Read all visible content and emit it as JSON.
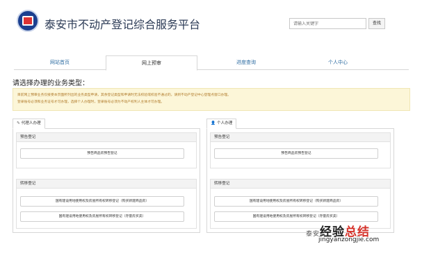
{
  "header": {
    "site_title": "泰安市不动产登记综合服务平台",
    "search_placeholder": "请输入关键字",
    "search_button": "查找"
  },
  "nav": {
    "items": [
      {
        "label": "网站首页"
      },
      {
        "label": "网上预审",
        "active": true
      },
      {
        "label": "进度查询"
      },
      {
        "label": "个人中心"
      }
    ]
  },
  "prompt": "请选择办理的业务类型：",
  "notice": {
    "line1": "目前网上预审业务仅接受本页面所列出的业务类型申请，其余登记类型和申请时无法校验或校验不通过的，请到不动产登记中心登理点窗口办理。",
    "line2": "登录账号必须和业务证号才可办理，选择个人办理时，登录账号必须为不动产权利人主体才可办理。"
  },
  "panels": {
    "agent": {
      "tab_label": "代理人办理",
      "section1": {
        "title": "预告登记",
        "buttons": [
          "预告商品房预告登记"
        ]
      },
      "section2": {
        "title": "转移登记",
        "buttons": [
          "国有建设用地使用权及房屋所有权转移登记（购买新建商品房）",
          "国有建设用地使用权及房屋所有权转移登记（存量房买卖）"
        ]
      }
    },
    "personal": {
      "tab_label": "个人办理",
      "section1": {
        "title": "预告登记",
        "buttons": [
          "预告商品房预告登记"
        ]
      },
      "section2": {
        "title": "转移登记",
        "buttons": [
          "国有建设用地使用权及房屋所有权转移登记（购买新建商品房）",
          "国有建设用地使用权及房屋所有权转移登记（存量房买卖）"
        ]
      }
    }
  },
  "watermark": {
    "brand_prefix": "泰安",
    "brand_main": "经验",
    "brand_accent": "总结",
    "url": "jingyanzongjie.com"
  }
}
